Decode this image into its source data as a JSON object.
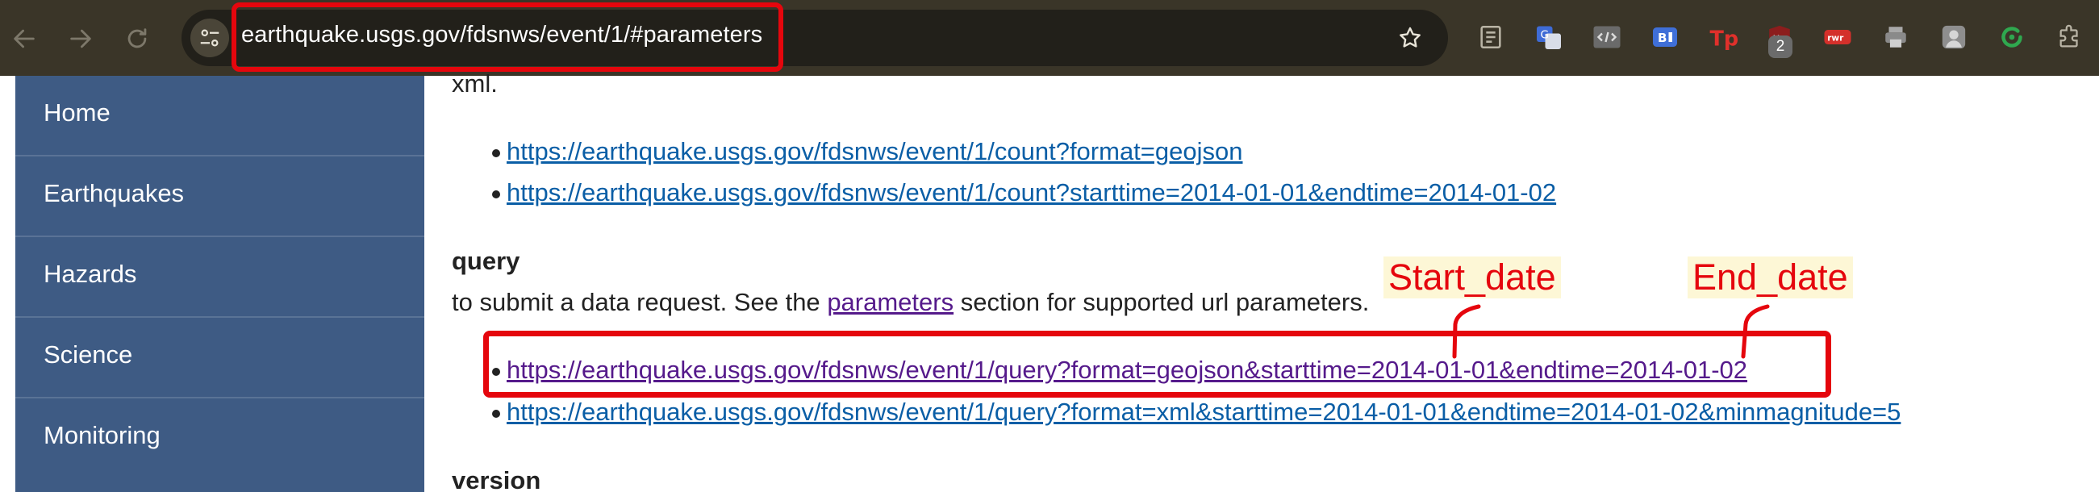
{
  "browser": {
    "url": "earthquake.usgs.gov/fdsnws/event/1/#parameters",
    "extension_badge": "2",
    "icons": [
      "back-icon",
      "forward-icon",
      "reload-icon",
      "site-info-icon",
      "bookmark-star-icon",
      "reader-mode-icon",
      "translate-icon",
      "code-view-icon",
      "bi-extension-icon",
      "tp-extension-icon",
      "ublock-icon",
      "rwr-extension-icon",
      "printer-icon",
      "avatar-extension-icon",
      "refresh-extension-icon",
      "extensions-puzzle-icon"
    ]
  },
  "sidebar": {
    "items": [
      {
        "label": "Home"
      },
      {
        "label": "Earthquakes"
      },
      {
        "label": "Hazards"
      },
      {
        "label": "Science"
      },
      {
        "label": "Monitoring"
      }
    ]
  },
  "content": {
    "top_fragment": "xml.",
    "count_links": [
      "https://earthquake.usgs.gov/fdsnws/event/1/count?format=geojson",
      "https://earthquake.usgs.gov/fdsnws/event/1/count?starttime=2014-01-01&endtime=2014-01-02"
    ],
    "query_heading": "query",
    "query_desc_before": "to submit a data request. See the",
    "query_desc_link": "parameters",
    "query_desc_after": "section for supported url parameters.",
    "query_links": [
      "https://earthquake.usgs.gov/fdsnws/event/1/query?format=geojson&starttime=2014-01-01&endtime=2014-01-02",
      "https://earthquake.usgs.gov/fdsnws/event/1/query?format=xml&starttime=2014-01-01&endtime=2014-01-02&minmagnitude=5"
    ],
    "version_heading": "version"
  },
  "annotations": {
    "start_label": "Start_date",
    "end_label": "End_date",
    "color": "#e5060d"
  }
}
